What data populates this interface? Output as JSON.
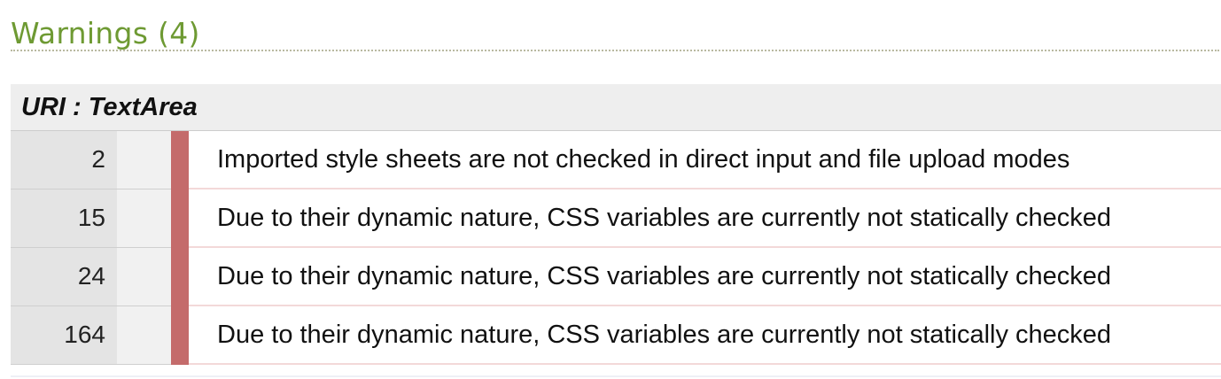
{
  "heading": "Warnings (4)",
  "uri_header": {
    "label": "URI : TextArea"
  },
  "warnings": [
    {
      "line": "2",
      "message": "Imported style sheets are not checked in direct input and file upload modes"
    },
    {
      "line": "15",
      "message": "Due to their dynamic nature, CSS variables are currently not statically checked"
    },
    {
      "line": "24",
      "message": "Due to their dynamic nature, CSS variables are currently not statically checked"
    },
    {
      "line": "164",
      "message": "Due to their dynamic nature, CSS variables are currently not statically checked"
    }
  ],
  "colors": {
    "heading": "#6e9a33",
    "marker": "#c46b6b",
    "header_bg": "#eeeeee",
    "linenum_bg": "#e4e4e4"
  }
}
